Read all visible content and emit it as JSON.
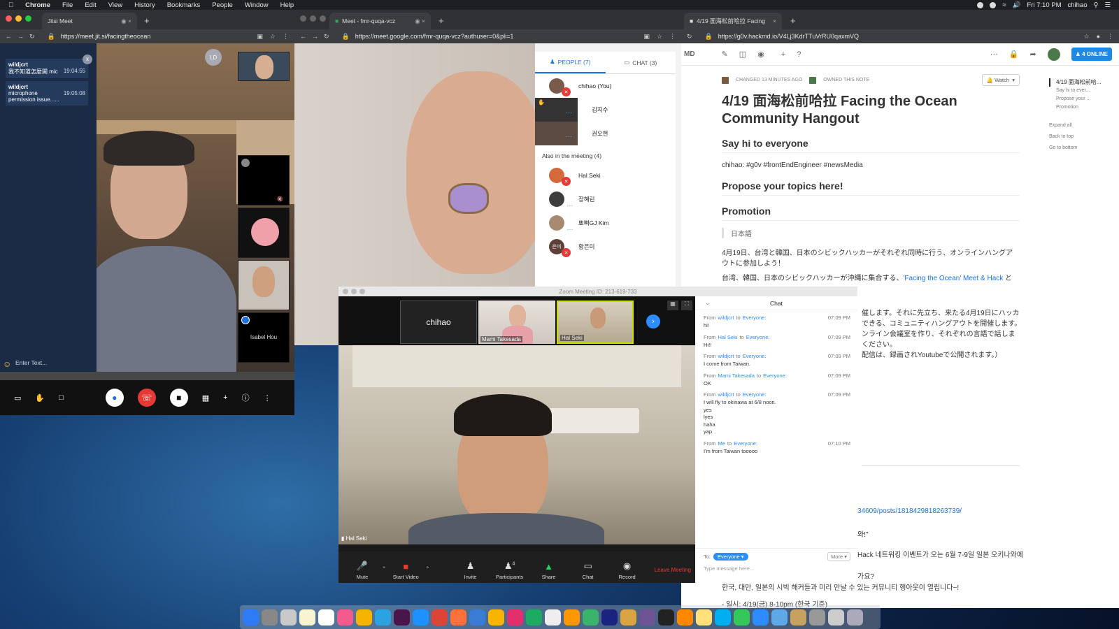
{
  "menubar": {
    "items": [
      "Chrome",
      "File",
      "Edit",
      "View",
      "History",
      "Bookmarks",
      "People",
      "Window",
      "Help"
    ],
    "clock": "Fri 7:10 PM",
    "user": "chihao"
  },
  "jitsi": {
    "tab_title": "Jitsi Meet",
    "url": "https://meet.jit.si/facingtheocean",
    "messages": [
      {
        "user": "wildjcrt",
        "text": "我不知道怎麼開 mic",
        "time": "19:04:55"
      },
      {
        "user": "wildjcrt",
        "text": "microphone permission issue......",
        "time": "19:05:08"
      }
    ],
    "input_placeholder": "Enter Text...",
    "avatar_initials": "LD",
    "thumb_name": "Isabel Hou"
  },
  "gmeet": {
    "tab_title": "Meet - fmr-quqa-vcz",
    "url": "https://meet.google.com/fmr-quqa-vcz?authuser=0&pli=1",
    "people_tab": "PEOPLE (7)",
    "chat_tab": "CHAT (3)",
    "people": [
      "chihao (You)",
      "김지수",
      "권오현"
    ],
    "also_title": "Also in the meeting (4)",
    "also": [
      "Hal Seki",
      "장혜린",
      "뽀삐GJ Kim",
      "황은미"
    ],
    "also_avatar_text": "은미"
  },
  "hackmd": {
    "tab_title": "4/19 面海松前哈拉 Facing the Oce",
    "url": "https://g0v.hackmd.io/V4Lj3KdrTTuVrRU0qaxmVQ",
    "mode_label": "MD",
    "online": "4 ONLINE",
    "changed": "CHANGED 13 MINUTES AGO",
    "owned": "OWNED THIS NOTE",
    "watch": "Watch",
    "title": "4/19 面海松前哈拉 Facing the Ocean Community Hangout",
    "h_sayhi": "Say hi to everyone",
    "p_sayhi": "chihao: #g0v #frontEndEngineer #newsMedia",
    "h_topics": "Propose your topics here!",
    "h_promo": "Promotion",
    "quote": "日本語",
    "p1": "4月19日、台湾と韓国、日本のシビックハッカーがそれぞれ同時に行う、オンラインハングアウトに参加しよう！",
    "p2a": "台湾、韓国、日本のシビックハッカーが沖縄に集合する、",
    "p2link": "'Facing the Ocean' Meet & Hack",
    "p2b": " と",
    "p3": "催します。それに先立ち、来たる4月19日にハッカ",
    "p4": "できる、コミュニティハングアウトを開催します。",
    "p5": "ンライン会議室を作り、それぞれの言語で話しま",
    "p6": "ください。",
    "p7": "配信は、録画されYoutubeで公開されます。）",
    "link2": "34609/posts/1818429818263739/",
    "kr_frag": "와!\"",
    "kr1": "Hack 네트워킹 이벤트가 오는 6월 7-9일 일본 오키나와에",
    "kr2": "가요?",
    "kr3": "한국, 대만, 일본의 시빅 해커들과 미리 만날 수 있는 커뮤니티 행아웃이 열립니다~!",
    "kr4": "- 일시: 4/19(금) 8-10pm (한국 기준)",
    "toc": [
      "4/19 面海松前哈...",
      "Say hi to ever...",
      "Propose your ...",
      "Promotion"
    ],
    "toc_actions": [
      "Expand all",
      "Back to top",
      "Go to bottom"
    ]
  },
  "zoom": {
    "title": "Zoom Meeting ID: 213-619-733",
    "strip": [
      "chihao",
      "Mami Takesada",
      "Hal Seki"
    ],
    "main_name": "Hal Seki",
    "controls": [
      "Mute",
      "Start Video",
      "Invite",
      "Participants",
      "Share",
      "Chat",
      "Record"
    ],
    "participants_count": "4",
    "leave": "Leave Meeting",
    "chat_title": "Chat",
    "chat": [
      {
        "from": "wildjcrt",
        "to": "Everyone:",
        "time": "07:09 PM",
        "text": "hi!"
      },
      {
        "from": "Hal Seki",
        "to": "Everyone:",
        "time": "07:09 PM",
        "text": "Hi!!"
      },
      {
        "from": "wildjcrt",
        "to": "Everyone:",
        "time": "07:09 PM",
        "text": "I come from Taiwan."
      },
      {
        "from": "Mami Takesada",
        "to": "Everyone:",
        "time": "07:09 PM",
        "text": "OK"
      },
      {
        "from": "wildjcrt",
        "to": "Everyone:",
        "time": "07:09 PM",
        "text": "I will fly to okinawa at 6/8 noon.\nyes\nlyes\nhaha\nyap"
      },
      {
        "from": "Me",
        "to": "Everyone:",
        "time": "07:10 PM",
        "text": "I'm from Taiwan tooooo"
      }
    ],
    "to_label": "To:",
    "to_value": "Everyone",
    "more": "More",
    "input_placeholder": "Type message here..."
  }
}
